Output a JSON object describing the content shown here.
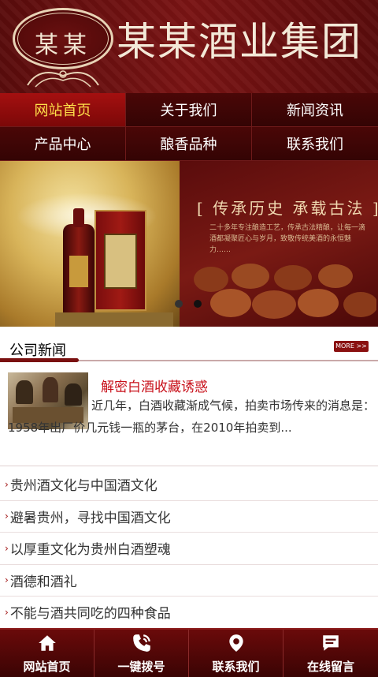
{
  "header": {
    "seal_text": "某某",
    "brand": "某某酒业集团"
  },
  "nav": {
    "items": [
      {
        "label": "网站首页",
        "active": true
      },
      {
        "label": "关于我们",
        "active": false
      },
      {
        "label": "新闻资讯",
        "active": false
      },
      {
        "label": "产品中心",
        "active": false
      },
      {
        "label": "酿香品种",
        "active": false
      },
      {
        "label": "联系我们",
        "active": false
      }
    ]
  },
  "banner": {
    "slogan": "[ 传承历史 承载古法 ]",
    "desc": "二十多年专注酿造工艺，传承古法精酿，让每一滴酒都凝聚匠心与岁月，致敬传统美酒的永恒魅力……",
    "slide_count": 2,
    "active_slide": 2
  },
  "news_section": {
    "title": "公司新闻",
    "more": "MORE >>"
  },
  "featured": {
    "title": "解密白酒收藏诱惑",
    "text": "近几年，白酒收藏渐成气候，拍卖市场传来的消息是：1958年出厂价几元钱一瓶的茅台，在2010年拍卖到..."
  },
  "news_list": [
    "贵州酒文化与中国酒文化",
    "避暑贵州，寻找中国酒文化",
    "以厚重文化为贵州白酒塑魂",
    "酒德和酒礼",
    "不能与酒共同吃的四种食品"
  ],
  "bottom_bar": {
    "items": [
      {
        "label": "网站首页",
        "icon": "home-icon"
      },
      {
        "label": "一键拨号",
        "icon": "phone-icon"
      },
      {
        "label": "联系我们",
        "icon": "location-icon"
      },
      {
        "label": "在线留言",
        "icon": "message-icon"
      }
    ]
  },
  "colors": {
    "brand_dark": "#3b0506",
    "brand_red": "#7a1414",
    "active_nav": "#a41010",
    "active_nav_text": "#ffe14a",
    "featured_title": "#c8101a"
  }
}
